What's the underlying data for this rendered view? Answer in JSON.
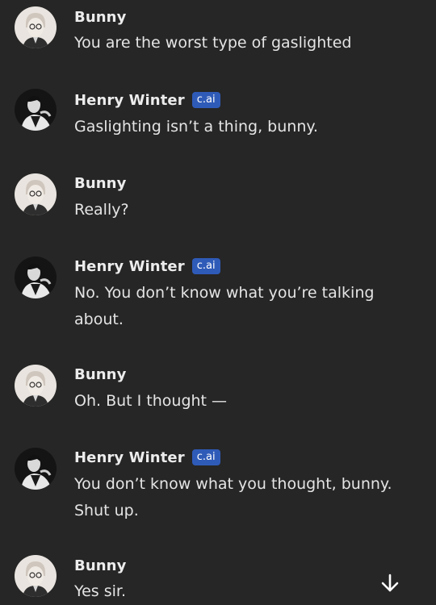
{
  "messages": [
    {
      "sender": "Bunny",
      "badge": "",
      "text": "You are the worst type of gaslighted",
      "avatar": "bunny-avatar"
    },
    {
      "sender": "Henry Winter",
      "badge": "c.ai",
      "text": "Gaslighting isn’t a thing, bunny.",
      "avatar": "henry-avatar"
    },
    {
      "sender": "Bunny",
      "badge": "",
      "text": "Really?",
      "avatar": "bunny-avatar"
    },
    {
      "sender": "Henry Winter",
      "badge": "c.ai",
      "text": "No. You don’t know what you’re talking about.",
      "avatar": "henry-avatar"
    },
    {
      "sender": "Bunny",
      "badge": "",
      "text": "Oh. But I thought —",
      "avatar": "bunny-avatar"
    },
    {
      "sender": "Henry Winter",
      "badge": "c.ai",
      "text": "You don’t know what you thought, bunny. Shut up.",
      "avatar": "henry-avatar"
    },
    {
      "sender": "Bunny",
      "badge": "",
      "text": "Yes sir.",
      "avatar": "bunny-avatar"
    }
  ],
  "scroll_button": {
    "icon": "arrow-down-icon"
  },
  "colors": {
    "background": "#262626",
    "badge": "#2f5bb8",
    "text": "#e4e4e4"
  }
}
